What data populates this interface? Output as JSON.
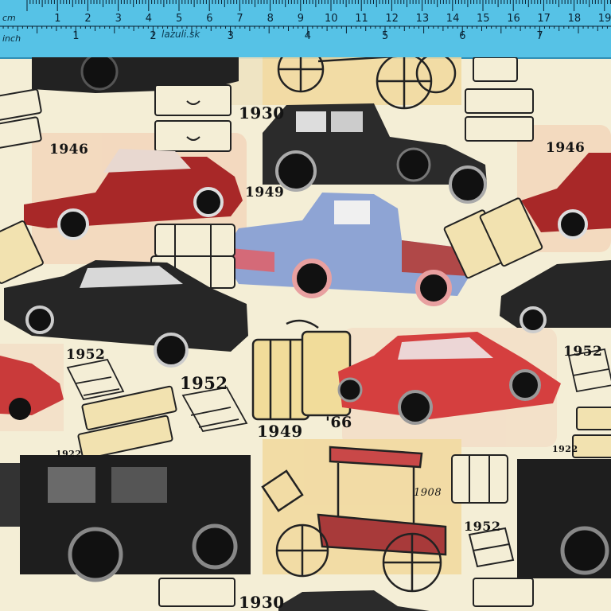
{
  "ruler": {
    "cm_label": "cm",
    "inch_label": "inch",
    "brand": "lazuli.sk",
    "cm_marks": [
      "1",
      "2",
      "3",
      "4",
      "5",
      "6",
      "7",
      "8",
      "9",
      "10",
      "11",
      "12",
      "13",
      "14",
      "15",
      "16",
      "17",
      "18",
      "19",
      "2"
    ],
    "inch_marks": [
      "1",
      "2",
      "3",
      "4",
      "5",
      "6",
      "7"
    ]
  },
  "fabric": {
    "years": {
      "y1930_top": "1930",
      "y1946_left": "1946",
      "y1946_right": "1946",
      "y1949_mid": "1949",
      "y1952_left": "1952",
      "y1952_center": "1952",
      "y1952_right": "1952",
      "y1949_low": "1949",
      "y66": "'66",
      "y1922_left": "1922",
      "y1922_right": "1922",
      "y1908": "1908",
      "y1952_bottom": "1952",
      "y1930_bottom": "1930"
    }
  },
  "colors": {
    "ruler": "#56c2e6",
    "fabric": "#f4eed6",
    "tan_patch": "#f2d9a0",
    "red_car": "#c23b3b",
    "blue_truck": "#8fa6d6",
    "black_car": "#2a2a2a"
  }
}
